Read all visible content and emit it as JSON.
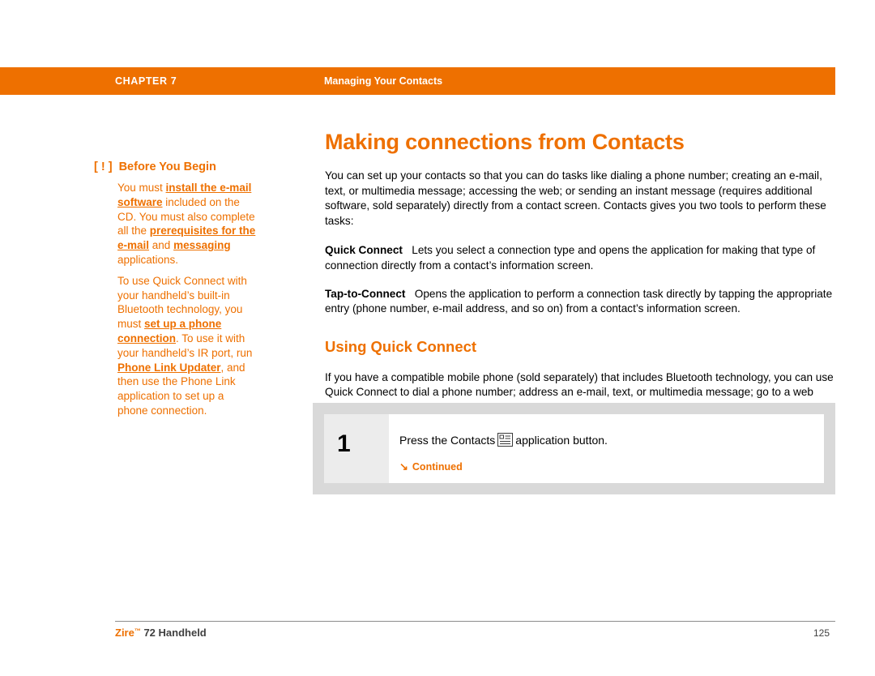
{
  "header": {
    "chapter": "CHAPTER 7",
    "section": "Managing Your Contacts"
  },
  "sidebar": {
    "icon": "warning-bang-icon",
    "heading": "Before You Begin",
    "p1_a": "You must ",
    "p1_link1": "install the e-mail software",
    "p1_b": " included on the CD. You must also complete all the ",
    "p1_link2": "prerequisites for the e-mail",
    "p1_c": " and ",
    "p1_link3": "messaging",
    "p1_d": " applications.",
    "p2_a": "To use Quick Connect with your handheld’s built-in Bluetooth technology, you must ",
    "p2_link1": "set up a phone connection",
    "p2_b": ". To use it with your handheld’s IR port, run ",
    "p2_link2": "Phone Link Updater",
    "p2_c": ", and then use the Phone Link application to set up a phone connection."
  },
  "main": {
    "title": "Making connections from Contacts",
    "intro_a": "You can set up your contacts so that you can do tasks like dialing a phone number; creating an e-mail, text, or multimedia message; accessing the web; or sending an instant message (",
    "intro_requires": "requires additional software, sold separately",
    "intro_b": ") directly from a contact screen. Contacts gives you two tools to perform these tasks:",
    "quick_connect_label": "Quick Connect",
    "quick_connect_text": "Lets you select a connection type and opens the application for making that type of connection directly from a contact’s information screen.",
    "tap_to_connect_label": "Tap-to-Connect",
    "tap_to_connect_text": "Opens the application to perform a connection task directly by tapping the appropriate entry (phone number, e-mail address, and so on) from a contact’s information screen.",
    "section_title": "Using Quick Connect",
    "section_body": "If you have a compatible mobile phone (sold separately) that includes Bluetooth technology, you can use Quick Connect to dial a phone number; address an e-mail, text, or multimedia message; go to a web site; or send an instant message (requires additional software, sold separately) directly from a contact."
  },
  "step": {
    "number": "1",
    "text_before": "Press the Contacts",
    "icon": "contacts-application-icon",
    "text_after": "application button.",
    "continued": "Continued",
    "continued_icon": "arrow-down-right-icon"
  },
  "footer": {
    "product": "Zire",
    "tm": "™",
    "product_suffix": " 72 Handheld",
    "page": "125"
  },
  "colors": {
    "accent": "#ee7000",
    "header_bar": "#ee7000",
    "step_box": "#d9d9d9",
    "step_num_cell": "#ececec"
  }
}
